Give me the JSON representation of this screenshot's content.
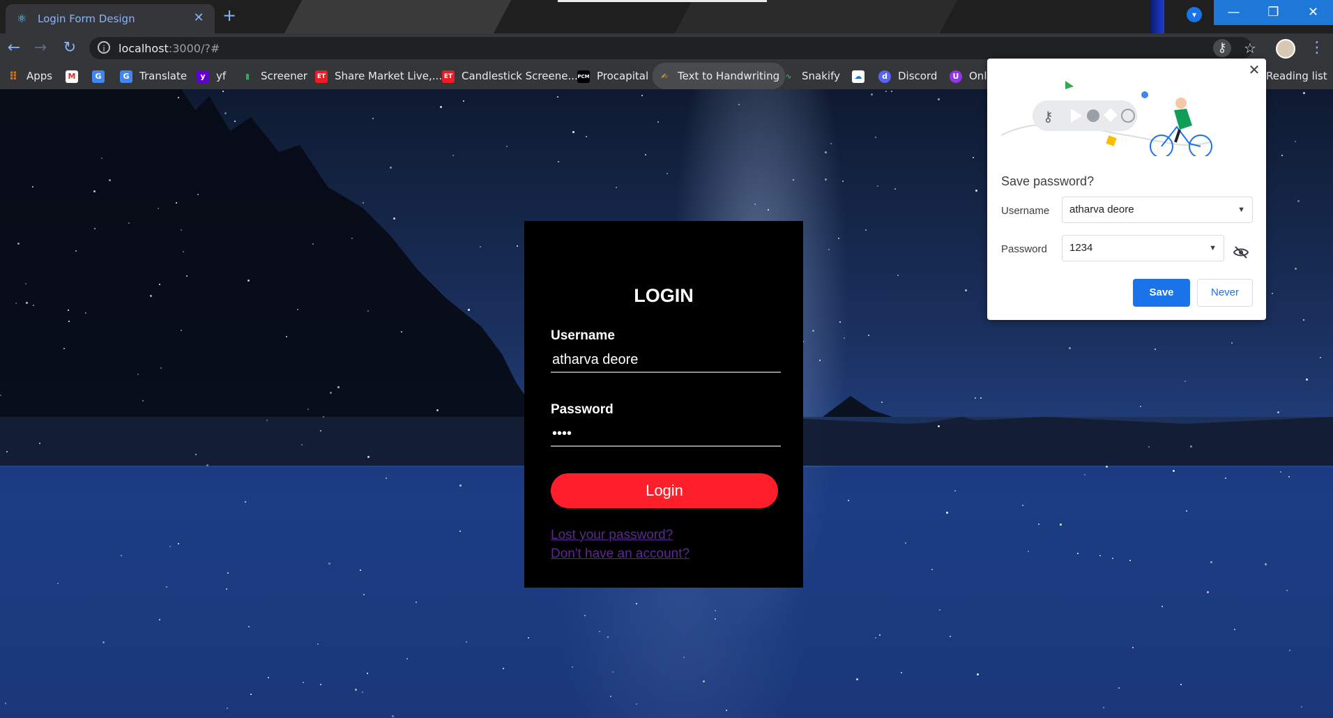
{
  "browser": {
    "tab_title": "Login Form Design",
    "url_host": "localhost",
    "url_rest": ":3000/?#",
    "colors": {
      "chrome_dark": "#35363a",
      "accent_blue": "#8ab4f8",
      "window_blue": "#1e78d8"
    }
  },
  "bookmarks": [
    {
      "label": "Apps",
      "icon": "apps-grid-icon"
    },
    {
      "label": "",
      "icon": "gmail-icon"
    },
    {
      "label": "",
      "icon": "google-sheets-icon"
    },
    {
      "label": "Translate",
      "icon": "translate-icon"
    },
    {
      "label": "yf",
      "icon": "yahoo-finance-icon"
    },
    {
      "label": "Screener",
      "icon": "bar-chart-icon"
    },
    {
      "label": "Share Market Live,...",
      "icon": "et-icon"
    },
    {
      "label": "Candlestick Screene...",
      "icon": "et-icon"
    },
    {
      "label": "Procapital",
      "icon": "pcm-icon"
    },
    {
      "label": "Text to Handwriting",
      "icon": "handwriting-icon"
    },
    {
      "label": "Snakify",
      "icon": "snake-icon"
    },
    {
      "label": "",
      "icon": "cloud-icon"
    },
    {
      "label": "Discord",
      "icon": "discord-icon"
    },
    {
      "label": "Onl",
      "icon": "online-icon"
    },
    {
      "label": "Reading list",
      "icon": "reading-list-icon"
    }
  ],
  "login": {
    "title": "LOGIN",
    "username_label": "Username",
    "username_value": "atharva deore",
    "password_label": "Password",
    "password_value": "••••",
    "login_button": "Login",
    "lost_password": "Lost your password?",
    "no_account": "Don't have an account?",
    "accent": "#ff1f2b"
  },
  "save_popup": {
    "heading": "Save password?",
    "username_label": "Username",
    "username_value": "atharva deore",
    "password_label": "Password",
    "password_value": "1234",
    "save_button": "Save",
    "never_button": "Never",
    "save_color": "#1a73e8"
  }
}
